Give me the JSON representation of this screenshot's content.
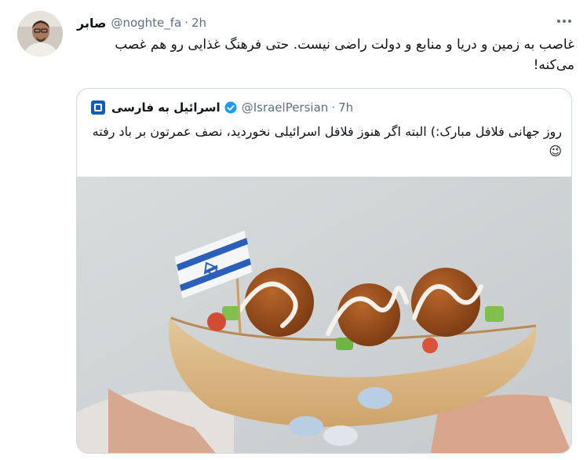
{
  "tweet": {
    "display_name": "صابر",
    "handle": "@noghte_fa",
    "separator": "·",
    "time": "2h",
    "text": "غاصب به زمین و دریا و منابع و دولت راضی نیست. حتی فرهنگ غذایی رو هم غصب می‌کنه!"
  },
  "quoted_tweet": {
    "display_name": "اسرائیل به فارسی",
    "handle": "@IsraelPersian",
    "separator": "·",
    "time": "7h",
    "text": "روز جهانی فلافل مبارک:) البته اگر هنوز فلافل اسرائیلی نخوردید، نصف عمرتون بر باد رفته😉"
  },
  "icons": {
    "more": "more-horizontal-icon",
    "verified": "verified-badge-icon",
    "flag": "israel-flag-icon"
  },
  "colors": {
    "text_primary": "#0f1419",
    "text_secondary": "#5b7083",
    "verified": "#1d9bf0",
    "border": "#cfd9de"
  }
}
